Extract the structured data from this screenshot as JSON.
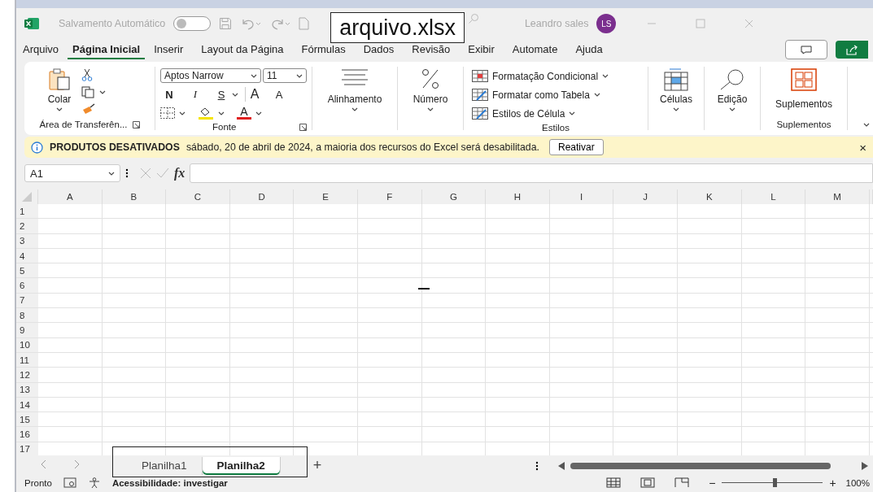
{
  "title_bar": {
    "autosave_label": "Salvamento Automático",
    "autosave_on": false,
    "file_name": "arquivo.xlsx",
    "user_name": "Leandro sales",
    "user_initials": "LS"
  },
  "menu_tabs": [
    {
      "label": "Arquivo",
      "selected": false
    },
    {
      "label": "Página Inicial",
      "selected": true
    },
    {
      "label": "Inserir",
      "selected": false
    },
    {
      "label": "Layout da Página",
      "selected": false
    },
    {
      "label": "Fórmulas",
      "selected": false
    },
    {
      "label": "Dados",
      "selected": false
    },
    {
      "label": "Revisão",
      "selected": false
    },
    {
      "label": "Exibir",
      "selected": false
    },
    {
      "label": "Automate",
      "selected": false
    },
    {
      "label": "Ajuda",
      "selected": false
    }
  ],
  "ribbon": {
    "clipboard": {
      "paste_label": "Colar",
      "group_label": "Área de Transferên..."
    },
    "font": {
      "name": "Aptos Narrow",
      "size": "11",
      "bold": "N",
      "italic": "I",
      "underline": "S",
      "grow": "A",
      "shrink": "A",
      "color_letter": "A",
      "group_label": "Fonte"
    },
    "alignment_label": "Alinhamento",
    "number_label": "Número",
    "styles": {
      "items": [
        "Formatação Condicional",
        "Formatar como Tabela",
        "Estilos de Célula"
      ],
      "group_label": "Estilos"
    },
    "cells_label": "Células",
    "editing_label": "Edição",
    "addins": {
      "label": "Suplementos",
      "group_label": "Suplementos"
    }
  },
  "info_bar": {
    "title": "PRODUTOS DESATIVADOS",
    "message": "sábado, 20 de abril de 2024, a maioria dos recursos do Excel será desabilitada.",
    "button": "Reativar",
    "close": "×"
  },
  "formula_bar": {
    "cell_ref": "A1",
    "fx": "fx"
  },
  "sheet": {
    "columns": [
      "A",
      "B",
      "C",
      "D",
      "E",
      "F",
      "G",
      "H",
      "I",
      "J",
      "K",
      "L",
      "M"
    ],
    "rows": [
      "1",
      "2",
      "3",
      "4",
      "5",
      "6",
      "7",
      "8",
      "9",
      "10",
      "11",
      "12",
      "13",
      "14",
      "15",
      "16",
      "17"
    ]
  },
  "sheet_tabs": [
    {
      "label": "Planilha1",
      "selected": false
    },
    {
      "label": "Planilha2",
      "selected": true
    }
  ],
  "add_sheet": "+",
  "status_bar": {
    "status": "Pronto",
    "accessibility": "Acessibilidade: investigar",
    "zoom": {
      "out": "−",
      "in": "+",
      "level": 0.52,
      "reading": "100%"
    }
  }
}
